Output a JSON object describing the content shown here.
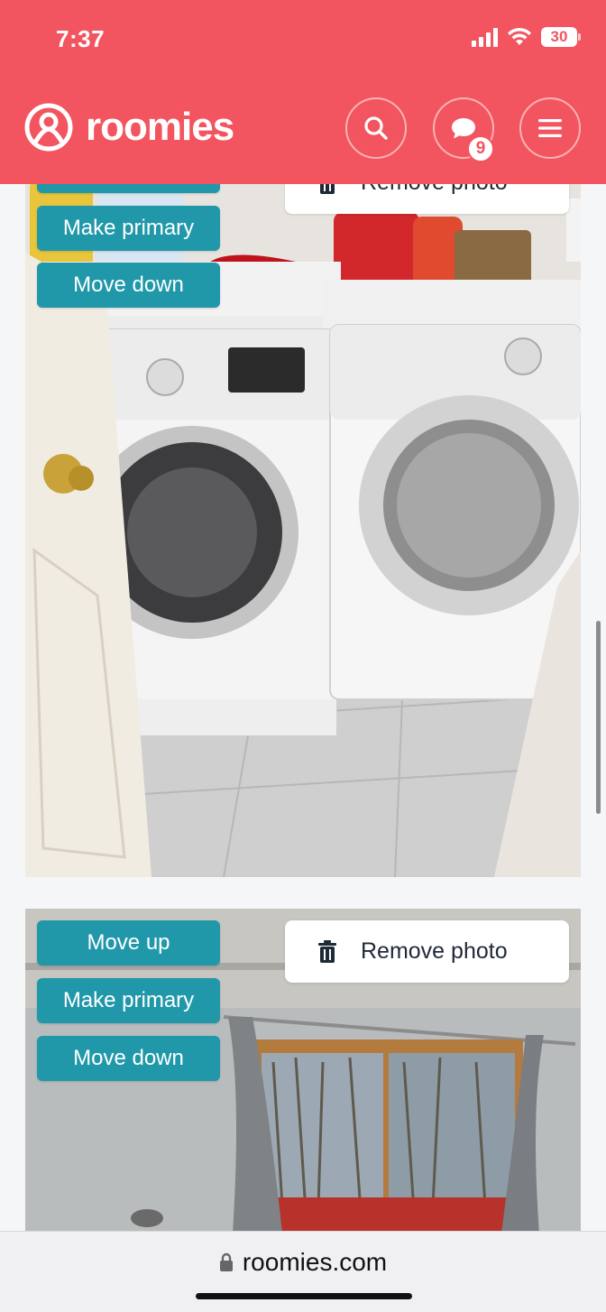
{
  "status_bar": {
    "time": "7:37",
    "battery": "30"
  },
  "header": {
    "brand": "roomies",
    "messages_badge": "9"
  },
  "photos": [
    {
      "buttons": {
        "make_primary": "Make primary",
        "move_down": "Move down",
        "remove": "Remove photo"
      }
    },
    {
      "buttons": {
        "move_up": "Move up",
        "make_primary": "Make primary",
        "move_down": "Move down",
        "remove": "Remove photo"
      }
    }
  ],
  "browser": {
    "url": "roomies.com"
  },
  "colors": {
    "brand": "#f25560",
    "button": "#2198aa"
  },
  "icons": [
    "search-icon",
    "chat-icon",
    "menu-icon",
    "trash-icon",
    "lock-icon"
  ]
}
